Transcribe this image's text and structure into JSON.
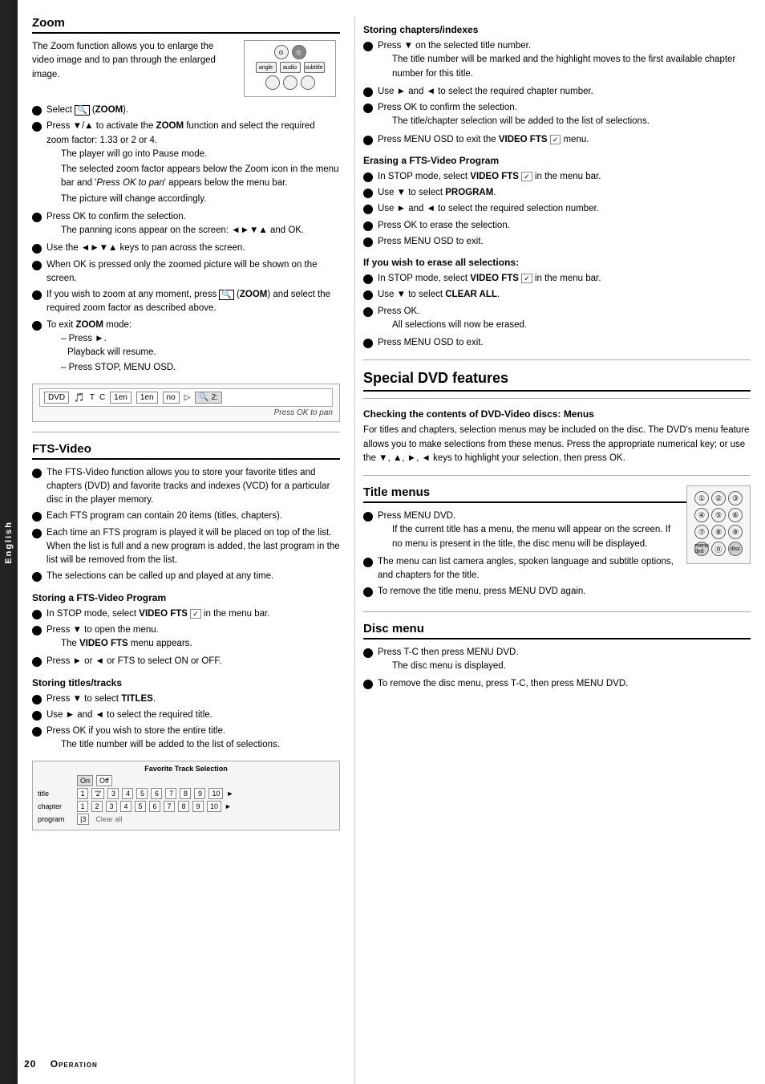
{
  "sidebar": {
    "label": "English"
  },
  "page_number": "20",
  "footer_label": "Operation",
  "left": {
    "zoom_section": {
      "title": "Zoom",
      "intro": "The Zoom function allows you to enlarge the video image and to pan through the enlarged image.",
      "bullets": [
        {
          "text": "Select",
          "bold_part": "(ZOOM).",
          "bold_before": false,
          "zoom_icon": true
        },
        {
          "text": "Press ▼/▲ to activate the",
          "bold_word": "ZOOM",
          "rest": "function and select the required zoom factor: 1.33 or 2 or 4.",
          "sub_indent": "The player will go into Pause mode.",
          "sub_indent2": "The selected zoom factor appears below the Zoom icon in the menu bar and 'Press OK to pan' appears below the menu bar.",
          "sub_indent3": "The picture will change accordingly."
        },
        {
          "text": "Press OK to confirm the selection.",
          "sub_indent": "The panning icons appear on the screen: ◄►▼▲ and OK."
        },
        {
          "text": "Use the ◄►▼▲ keys to pan across the screen."
        },
        {
          "text": "When OK is pressed only the zoomed picture will be shown on the screen."
        },
        {
          "text": "If you wish to zoom at any moment, press",
          "bold_zoom": "(ZOOM)",
          "rest2": "and select the required zoom factor as described above."
        },
        {
          "text": "To exit ZOOM mode:",
          "sub_dash1": "Press ►.",
          "sub_dash1_indent": "Playback will resume.",
          "sub_dash2": "Press STOP, MENU OSD."
        }
      ]
    },
    "fts_section": {
      "title": "FTS-Video",
      "bullets": [
        "The FTS-Video function allows you to store your favorite titles and chapters (DVD) and favorite tracks and indexes (VCD) for a particular disc in the player memory.",
        "Each FTS program can contain 20 items (titles, chapters).",
        "Each time an FTS program is played it will be placed on top of the list. When the list is full and a new program is added, the last program in the list will be removed from the list.",
        "The selections can be called up and played at any time."
      ],
      "storing_title": "Storing a FTS-Video Program",
      "storing_bullets": [
        {
          "text": "In STOP mode, select",
          "bold": "VIDEO FTS",
          "icon": "✓",
          "rest": "in the menu bar."
        },
        {
          "text": "Press ▼ to open the menu.",
          "sub_indent": "The VIDEO FTS menu appears.",
          "sub_bold": "VIDEO FTS"
        },
        {
          "text": "Press ► or ◄ or FTS to select ON or OFF."
        }
      ],
      "storing_titles_title": "Storing titles/tracks",
      "storing_titles_bullets": [
        {
          "text": "Press ▼ to select",
          "bold": "TITLES."
        },
        {
          "text": "Use ► and ◄ to select the required title."
        },
        {
          "text": "Press OK if you wish to store the entire title.",
          "sub_indent": "The title number will be added to the list of selections."
        }
      ]
    }
  },
  "right": {
    "storing_chapters_title": "Storing chapters/indexes",
    "storing_chapters_bullets": [
      {
        "text": "Press ▼ on the selected title number.",
        "sub_indent": "The title number will be marked and the highlight moves to the first available chapter number for this title."
      },
      {
        "text": "Use ► and ◄ to select the required chapter number."
      },
      {
        "text": "Press OK to confirm the selection.",
        "sub_indent": "The title/chapter selection will be added to the list of selections."
      },
      {
        "text": "Press MENU OSD to exit the",
        "bold": "VIDEO FTS",
        "icon": "✓",
        "rest": "menu."
      }
    ],
    "erasing_title": "Erasing a FTS-Video Program",
    "erasing_bullets": [
      {
        "text": "In STOP mode, select",
        "bold": "VIDEO FTS",
        "icon": "✓",
        "rest": "in the menu bar."
      },
      {
        "text": "Use ▼ to select",
        "bold": "PROGRAM."
      },
      {
        "text": "Use ► and ◄ to select the required selection number."
      },
      {
        "text": "Press OK to erase the selection."
      },
      {
        "text": "Press MENU OSD to exit."
      }
    ],
    "clear_all_title": "If you wish to erase all selections:",
    "clear_all_bullets": [
      {
        "text": "In STOP mode, select",
        "bold": "VIDEO FTS",
        "icon": "✓",
        "rest": "in the menu bar."
      },
      {
        "text": "Use ▼ to select",
        "bold": "CLEAR ALL."
      },
      {
        "text": "Press OK.",
        "sub_indent": "All selections will now be erased."
      },
      {
        "text": "Press MENU OSD to exit."
      }
    ],
    "special_dvd_title": "Special DVD features",
    "checking_title": "Checking the contents of DVD-Video discs: Menus",
    "checking_text": "For titles and chapters, selection menus may be included on the disc. The DVD's menu feature allows you to make selections from these menus. Press the appropriate numerical key; or use the ▼, ▲, ►, ◄ keys to highlight your selection, then press OK.",
    "title_menus_title": "Title menus",
    "title_menus_bullets": [
      {
        "text": "Press MENU DVD.",
        "sub_indent": "If the current title has a menu, the menu will appear on the screen. If no menu is present in the title, the disc menu will be displayed."
      },
      {
        "text": "The menu can list camera angles, spoken language and subtitle options, and chapters for the title."
      },
      {
        "text": "To remove the title menu, press MENU DVD again."
      }
    ],
    "disc_menu_title": "Disc menu",
    "disc_menu_bullets": [
      {
        "text": "Press T-C then press MENU DVD.",
        "sub_indent": "The disc menu is displayed."
      },
      {
        "text": "To remove the disc menu, press T-C, then press MENU DVD."
      }
    ]
  }
}
